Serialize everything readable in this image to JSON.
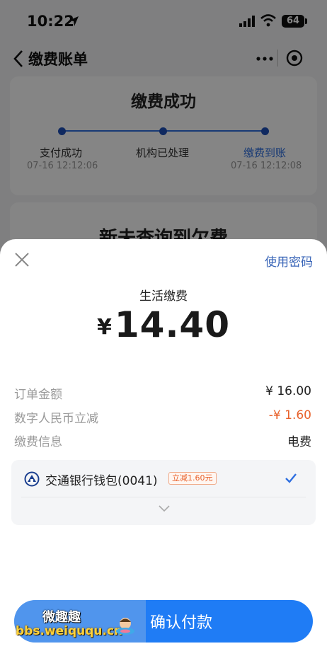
{
  "status_bar": {
    "time": "10:22",
    "battery": "64"
  },
  "nav": {
    "title": "缴费账单"
  },
  "progress_card": {
    "title": "缴费成功",
    "steps": [
      {
        "label": "支付成功",
        "time": "07-16 12:12:06"
      },
      {
        "label": "机构已处理",
        "time": ""
      },
      {
        "label": "缴费到账",
        "time": "07-16 12:12:08"
      }
    ]
  },
  "card2": {
    "title": "新未查询到欠费"
  },
  "sheet": {
    "use_password": "使用密码",
    "pay_title": "生活缴费",
    "currency": "¥",
    "amount": "14.40",
    "rows": [
      {
        "label": "订单金额",
        "value": "¥ 16.00"
      },
      {
        "label": "数字人民币立减",
        "value": "-¥ 1.60"
      },
      {
        "label": "缴费信息",
        "value": "电费"
      }
    ],
    "bank": {
      "name": "交通银行钱包(0041)",
      "badge": "立减1.60元"
    },
    "confirm_label": "确认付款"
  },
  "watermark": {
    "top": "微趣趣",
    "bottom": "bbs.weiququ.cn"
  },
  "colors": {
    "accent": "#1f7cf5",
    "discount": "#e8622c",
    "link": "#3a66b8"
  }
}
